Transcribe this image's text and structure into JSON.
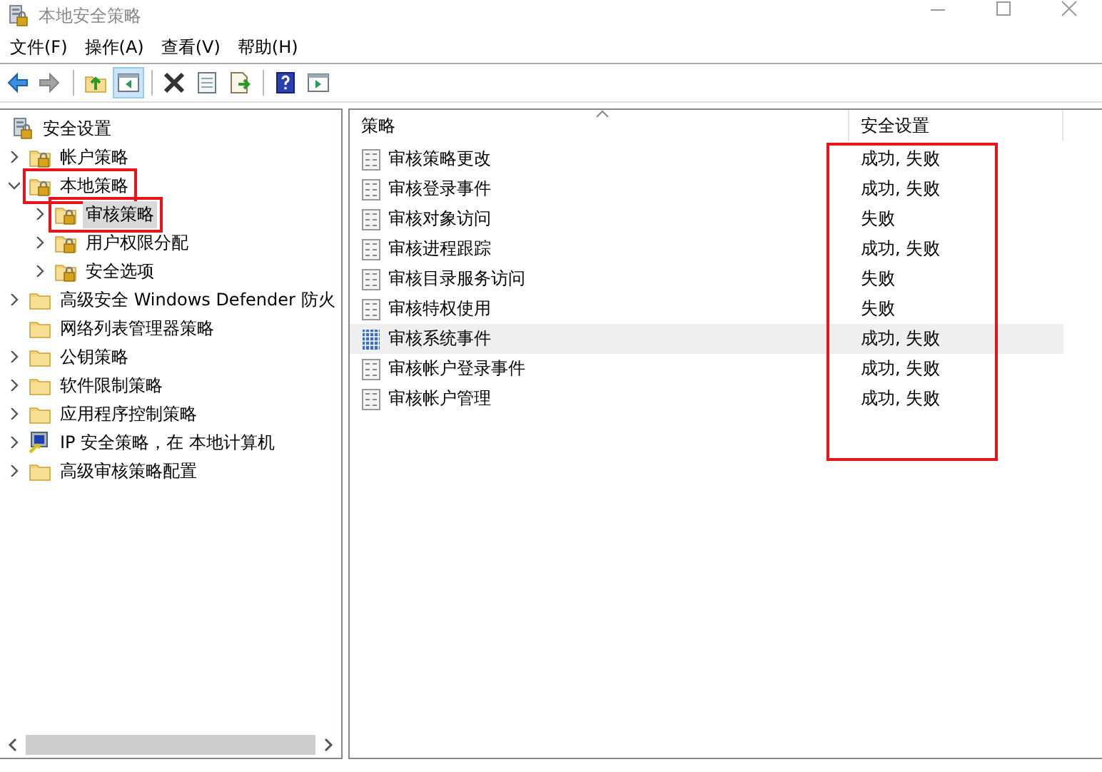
{
  "window": {
    "title": "本地安全策略"
  },
  "menu": [
    "文件(F)",
    "操作(A)",
    "查看(V)",
    "帮助(H)"
  ],
  "toolbar": [
    {
      "kind": "back",
      "disabled": false,
      "pressed": false
    },
    {
      "kind": "forward",
      "disabled": true,
      "pressed": false
    },
    {
      "kind": "sep"
    },
    {
      "kind": "up",
      "disabled": false,
      "pressed": false
    },
    {
      "kind": "tree",
      "disabled": false,
      "pressed": true
    },
    {
      "kind": "sep"
    },
    {
      "kind": "delete",
      "disabled": false,
      "pressed": false
    },
    {
      "kind": "properties",
      "disabled": false,
      "pressed": false
    },
    {
      "kind": "export",
      "disabled": false,
      "pressed": false
    },
    {
      "kind": "sep"
    },
    {
      "kind": "help",
      "disabled": false,
      "pressed": false
    },
    {
      "kind": "action-pane",
      "disabled": false,
      "pressed": false
    }
  ],
  "tree": [
    {
      "label": "安全设置",
      "kind": "lock-root",
      "selected": false,
      "highlighted": false,
      "children": [
        {
          "label": "帐户策略",
          "kind": "lock-folder",
          "expanded": false,
          "selected": false,
          "highlighted": false
        },
        {
          "label": "本地策略",
          "kind": "lock-folder",
          "expanded": true,
          "selected": false,
          "highlighted": true,
          "children": [
            {
              "label": "审核策略",
              "kind": "lock-folder",
              "expanded": false,
              "selected": true,
              "highlighted": true
            },
            {
              "label": "用户权限分配",
              "kind": "lock-folder",
              "expanded": false,
              "selected": false,
              "highlighted": false
            },
            {
              "label": "安全选项",
              "kind": "lock-folder",
              "expanded": false,
              "selected": false,
              "highlighted": false
            }
          ]
        },
        {
          "label": "高级安全 Windows Defender 防火",
          "kind": "folder",
          "expanded": false,
          "selected": false,
          "highlighted": false
        },
        {
          "label": "网络列表管理器策略",
          "kind": "folder",
          "selected": false,
          "highlighted": false
        },
        {
          "label": "公钥策略",
          "kind": "folder",
          "expanded": false,
          "selected": false,
          "highlighted": false
        },
        {
          "label": "软件限制策略",
          "kind": "folder",
          "expanded": false,
          "selected": false,
          "highlighted": false
        },
        {
          "label": "应用程序控制策略",
          "kind": "folder",
          "expanded": false,
          "selected": false,
          "highlighted": false
        },
        {
          "label": "IP 安全策略，在 本地计算机",
          "kind": "ip",
          "expanded": false,
          "selected": false,
          "highlighted": false
        },
        {
          "label": "高级审核策略配置",
          "kind": "folder",
          "expanded": false,
          "selected": false,
          "highlighted": false
        }
      ]
    }
  ],
  "policies": {
    "columns": [
      "策略",
      "安全设置"
    ],
    "settings_highlighted": true,
    "rows": [
      {
        "policy": "审核策略更改",
        "setting": "成功, 失败",
        "selected": false
      },
      {
        "policy": "审核登录事件",
        "setting": "成功, 失败",
        "selected": false
      },
      {
        "policy": "审核对象访问",
        "setting": "失败",
        "selected": false
      },
      {
        "policy": "审核进程跟踪",
        "setting": "成功, 失败",
        "selected": false
      },
      {
        "policy": "审核目录服务访问",
        "setting": "失败",
        "selected": false
      },
      {
        "policy": "审核特权使用",
        "setting": "失败",
        "selected": false
      },
      {
        "policy": "审核系统事件",
        "setting": "成功, 失败",
        "selected": true
      },
      {
        "policy": "审核帐户登录事件",
        "setting": "成功, 失败",
        "selected": false
      },
      {
        "policy": "审核帐户管理",
        "setting": "成功, 失败",
        "selected": false
      }
    ]
  }
}
